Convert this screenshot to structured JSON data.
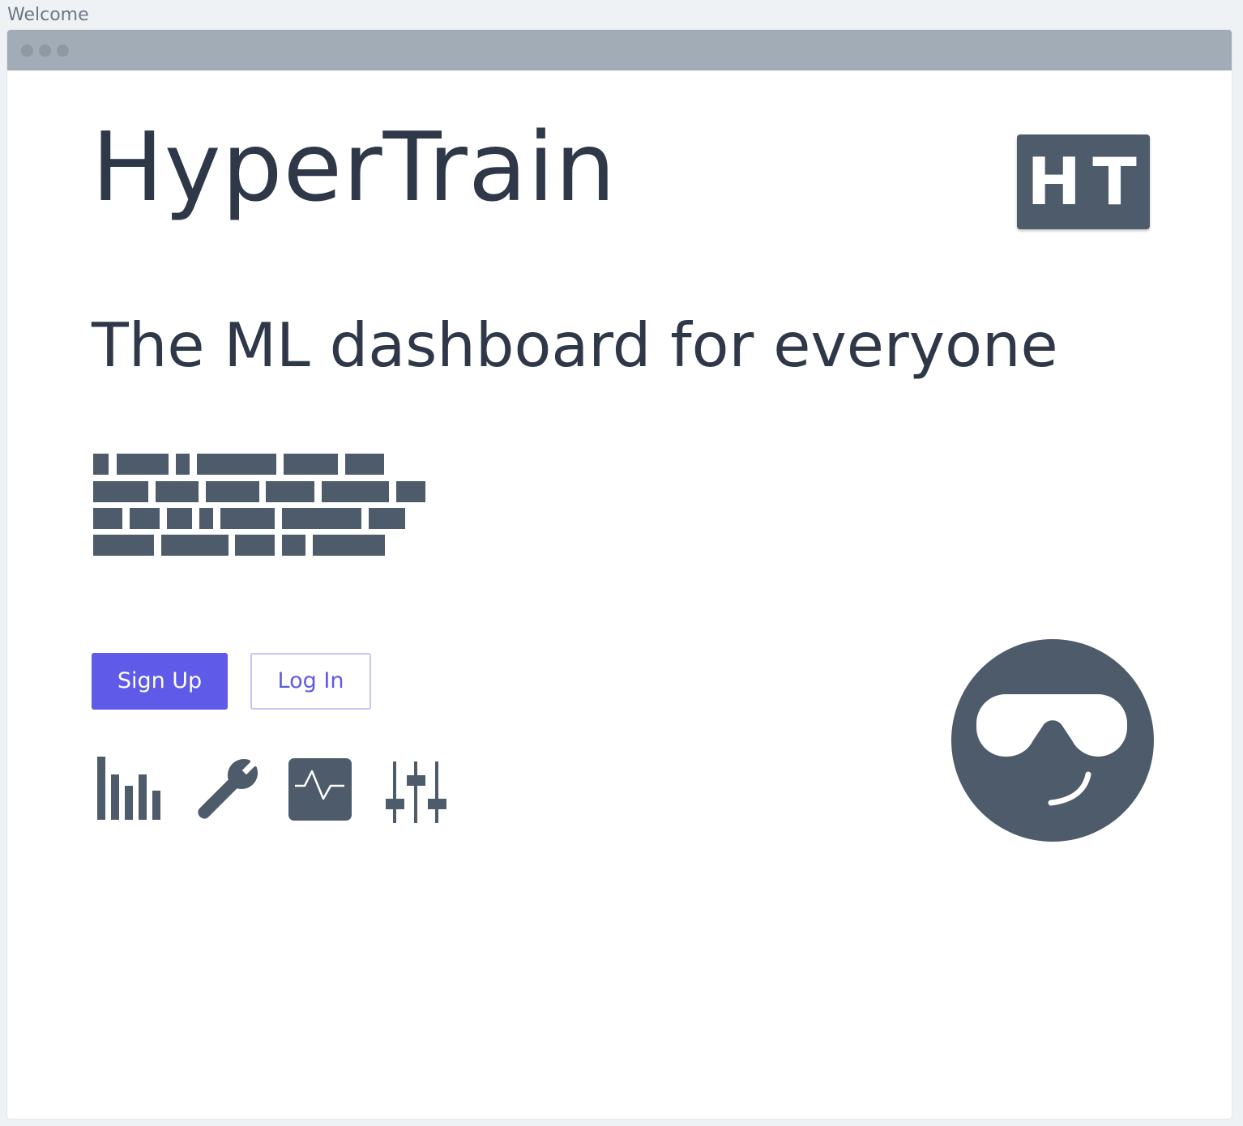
{
  "page": {
    "label": "Welcome"
  },
  "window": {
    "titlebar_color": "#a1acb7"
  },
  "app": {
    "title": "HyperTrain",
    "logo_text": "HT",
    "tagline": "The ML dashboard for everyone"
  },
  "actions": {
    "signup_label": "Sign Up",
    "login_label": "Log In"
  },
  "features": [
    {
      "icon": "bar-chart-icon"
    },
    {
      "icon": "wrench-icon"
    },
    {
      "icon": "activity-monitor-icon"
    },
    {
      "icon": "sliders-icon"
    }
  ],
  "mascot": {
    "icon": "sunglasses-smiley-icon"
  },
  "colors": {
    "text_dark": "#2e3848",
    "icon_slate": "#4e5b6b",
    "primary": "#5f5be8",
    "outline": "#c9c4f3",
    "page_bg": "#eff2f5"
  }
}
